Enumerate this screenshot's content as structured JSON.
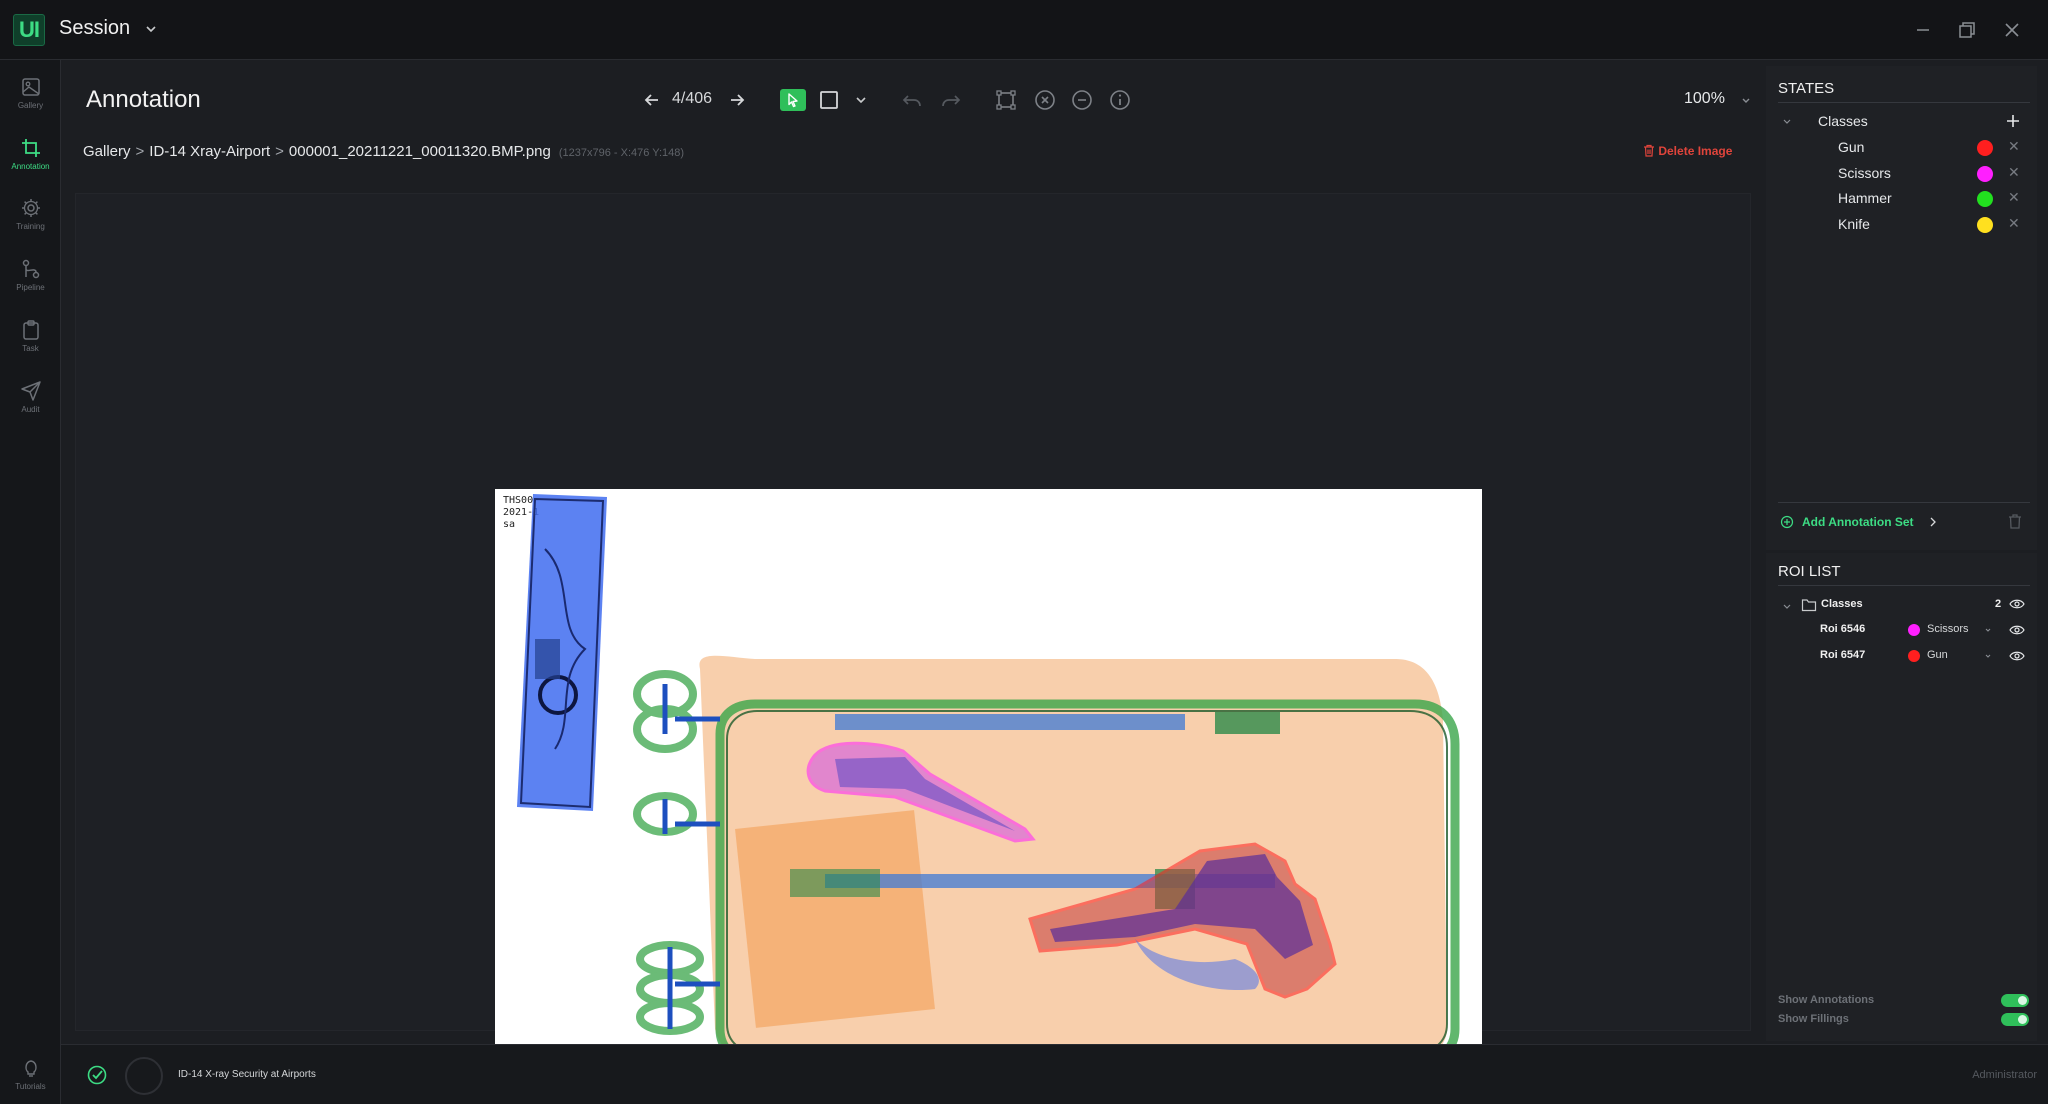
{
  "app": {
    "logo": "UI",
    "title": "Session",
    "title_menu_icon": "chevron-down-icon"
  },
  "window_controls": [
    "minimize-icon",
    "restore-icon",
    "close-icon"
  ],
  "nav": {
    "items": [
      {
        "label": "Gallery",
        "icon": "image-icon",
        "active": false
      },
      {
        "label": "Annotation",
        "icon": "crop-icon",
        "active": true
      },
      {
        "label": "Training",
        "icon": "gear-icon",
        "active": false
      },
      {
        "label": "Pipeline",
        "icon": "pipeline-icon",
        "active": false
      },
      {
        "label": "Task",
        "icon": "clipboard-icon",
        "active": false
      },
      {
        "label": "Audit",
        "icon": "send-icon",
        "active": false
      }
    ],
    "bottom": {
      "label": "Tutorials",
      "icon": "lightbulb-icon"
    }
  },
  "toolbar": {
    "title": "Annotation",
    "pager": "4/406",
    "zoom": "100%",
    "accent": "#2fbf5a"
  },
  "breadcrumb": {
    "items": [
      "Gallery",
      "ID-14 Xray-Airport",
      "000001_20211221_00011320.BMP.png"
    ],
    "separator": ">",
    "meta": "(1237x796 - X:476 Y:148)",
    "delete_label": "Delete Image"
  },
  "image": {
    "stamp": "THS00      \n2021-1   \nsa"
  },
  "states": {
    "heading": "STATES",
    "group_label": "Classes",
    "classes": [
      {
        "name": "Gun",
        "color": "#ff1f1f"
      },
      {
        "name": "Scissors",
        "color": "#ff1fff"
      },
      {
        "name": "Hammer",
        "color": "#22e01f"
      },
      {
        "name": "Knife",
        "color": "#ffe01f"
      }
    ],
    "add_set_label": "Add Annotation Set"
  },
  "roi_list": {
    "heading": "ROI LIST",
    "group_label": "Classes",
    "count": "2",
    "items": [
      {
        "name": "Roi 6546",
        "class": "Scissors",
        "color": "#ff1fff"
      },
      {
        "name": "Roi 6547",
        "class": "Gun",
        "color": "#ff1f1f"
      }
    ],
    "show_annotations_label": "Show Annotations",
    "show_fillings_label": "Show Fillings",
    "show_annotations": true,
    "show_fillings": true
  },
  "footer": {
    "project": "ID-14 X-ray Security at Airports",
    "role": "Administrator"
  }
}
